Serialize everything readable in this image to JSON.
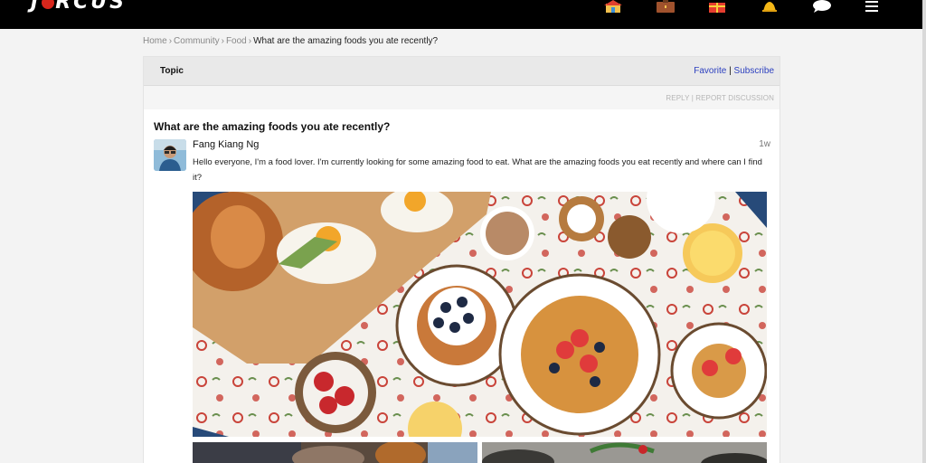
{
  "brand": {
    "logo_text_left": "J",
    "logo_text_right": "RCUS",
    "logo_ball_color": "#d8261c"
  },
  "nav": {
    "icons": [
      "home-icon",
      "briefcase-icon",
      "gift-icon",
      "bell-icon",
      "chat-icon",
      "menu-icon"
    ]
  },
  "breadcrumb": {
    "items": [
      "Home",
      "Community",
      "Food"
    ],
    "separator": "›",
    "current": "What are the amazing foods you ate recently?"
  },
  "panel": {
    "topic_label": "Topic",
    "favorite_label": "Favorite",
    "divider": "|",
    "subscribe_label": "Subscribe",
    "reply_label": "REPLY",
    "sub_divider": "|",
    "report_label": "REPORT DISCUSSION"
  },
  "post": {
    "title": "What are the amazing foods you ate recently?",
    "author": "Fang Kiang Ng",
    "time": "1w",
    "body": "Hello everyone, I'm a food lover. I'm currently looking for some amazing food to eat. What are the amazing foods you eat recently and where can I find it?"
  },
  "colors": {
    "link": "#2b3fbf",
    "topbar": "#000000",
    "panel_header": "#e9e9e9"
  }
}
